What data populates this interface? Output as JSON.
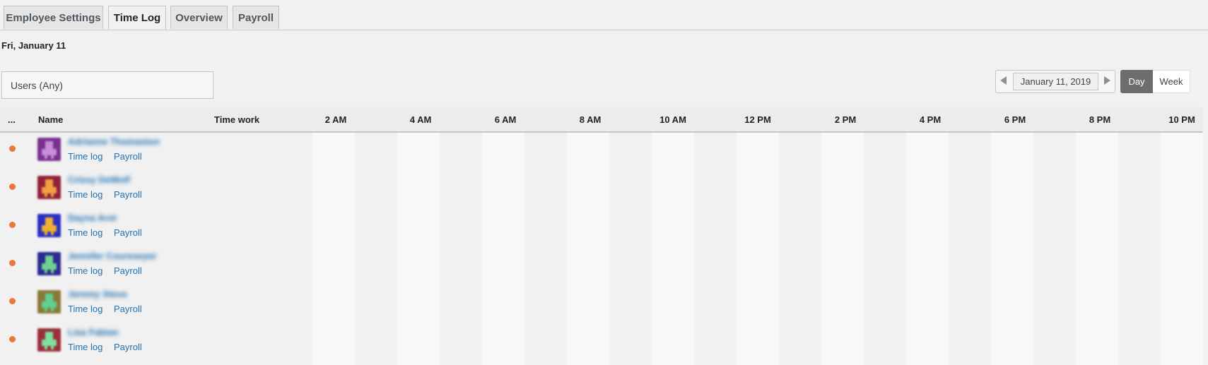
{
  "tabs": [
    "Employee Settings",
    "Time Log",
    "Overview",
    "Payroll"
  ],
  "active_tab": "Time Log",
  "date_heading": "Fri, January 11",
  "filter": {
    "users_label": "Users (Any)"
  },
  "date_nav": {
    "value": "January 11, 2019"
  },
  "view_toggle": {
    "day": "Day",
    "week": "Week",
    "selected": "Day"
  },
  "table": {
    "headers": {
      "status": "...",
      "name": "Name",
      "time_work": "Time work"
    },
    "hours": [
      "2 AM",
      "4 AM",
      "6 AM",
      "8 AM",
      "10 AM",
      "12 PM",
      "2 PM",
      "4 PM",
      "6 PM",
      "8 PM",
      "10 PM"
    ],
    "row_links": {
      "time_log": "Time log",
      "payroll": "Payroll"
    },
    "rows": [
      {
        "name": "Adrianne Thomaston",
        "avatar_colors": [
          "#7b2f8f",
          "#c88fd6"
        ]
      },
      {
        "name": "Crissy DeWolf",
        "avatar_colors": [
          "#8f1f3a",
          "#f0a040"
        ]
      },
      {
        "name": "Dayna Arot",
        "avatar_colors": [
          "#2a2fbf",
          "#f0b030"
        ]
      },
      {
        "name": "Jennifer Coureseyer",
        "avatar_colors": [
          "#2b2a8f",
          "#6fd08f"
        ]
      },
      {
        "name": "Jeremy Steve",
        "avatar_colors": [
          "#8a7a3a",
          "#5fd08f"
        ]
      },
      {
        "name": "Lisa Fabian",
        "avatar_colors": [
          "#9a2f3a",
          "#7fe0a0"
        ]
      }
    ]
  },
  "colors": {
    "status_dot": "#e9783a",
    "link": "#2271b1",
    "day_active": "#6d6d6d"
  }
}
